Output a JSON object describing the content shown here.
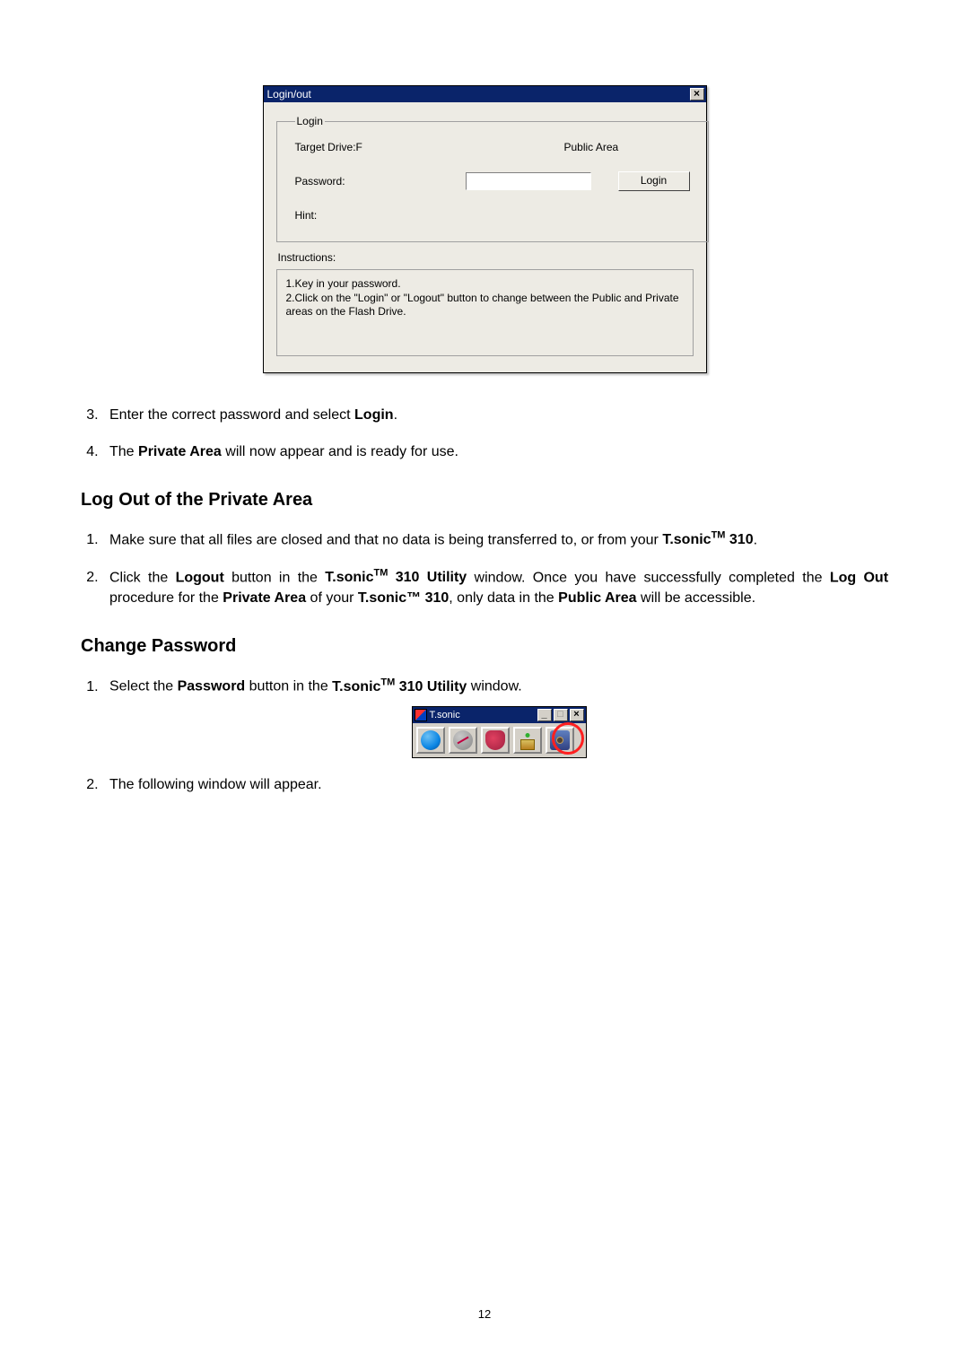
{
  "dialog": {
    "title": "Login/out",
    "close_label": "×",
    "legend": "Login",
    "target_drive_label": "Target Drive:F",
    "area_label": "Public Area",
    "password_label": "Password:",
    "login_btn": "Login",
    "hint_label": "Hint:",
    "instructions_label": "Instructions:",
    "instr1": "1.Key in your password.",
    "instr2": "2.Click on the \"Login\" or \"Logout\" button to change between the Public and Private areas on the Flash Drive."
  },
  "doc": {
    "step3_a": "Enter the correct password and select ",
    "step3_b": "Login",
    "step3_c": ".",
    "step4_a": "The ",
    "step4_b": "Private Area",
    "step4_c": " will now appear and is ready for use.",
    "heading2": "Log Out of the Private Area",
    "logout1_a": "Make sure that all files are closed and that no data is being transferred to, or from your ",
    "logout1_b": "T.sonic",
    "logout1_sup": "TM",
    "logout1_c": " 310",
    "logout1_d": ".",
    "logout2_a": "Click the ",
    "logout2_b": "Logout",
    "logout2_c": " button in the ",
    "logout2_d": "T.sonic",
    "logout2_sup": "TM",
    "logout2_e": " 310 Utility",
    "logout2_f": " window. Once you have successfully completed the ",
    "logout2_g": "Log Out",
    "logout2_h": " procedure for the ",
    "logout2_i": "Private Area",
    "logout2_j": " of your ",
    "logout2_k": "T.sonic™ 310",
    "logout2_l": ", only data in the ",
    "logout2_m": "Public Area",
    "logout2_n": " will be accessible.",
    "heading3": "Change Password",
    "chpw1_a": "Select the ",
    "chpw1_b": "Password",
    "chpw1_c": " button in the ",
    "chpw1_d": "T.sonic",
    "chpw1_sup": "TM",
    "chpw1_e": " 310 Utility",
    "chpw1_f": " window.",
    "chpw2": "The following window will appear."
  },
  "util": {
    "title": "T.sonic",
    "minimize": "_",
    "maximize": "□",
    "close": "×"
  },
  "page_number": "12"
}
